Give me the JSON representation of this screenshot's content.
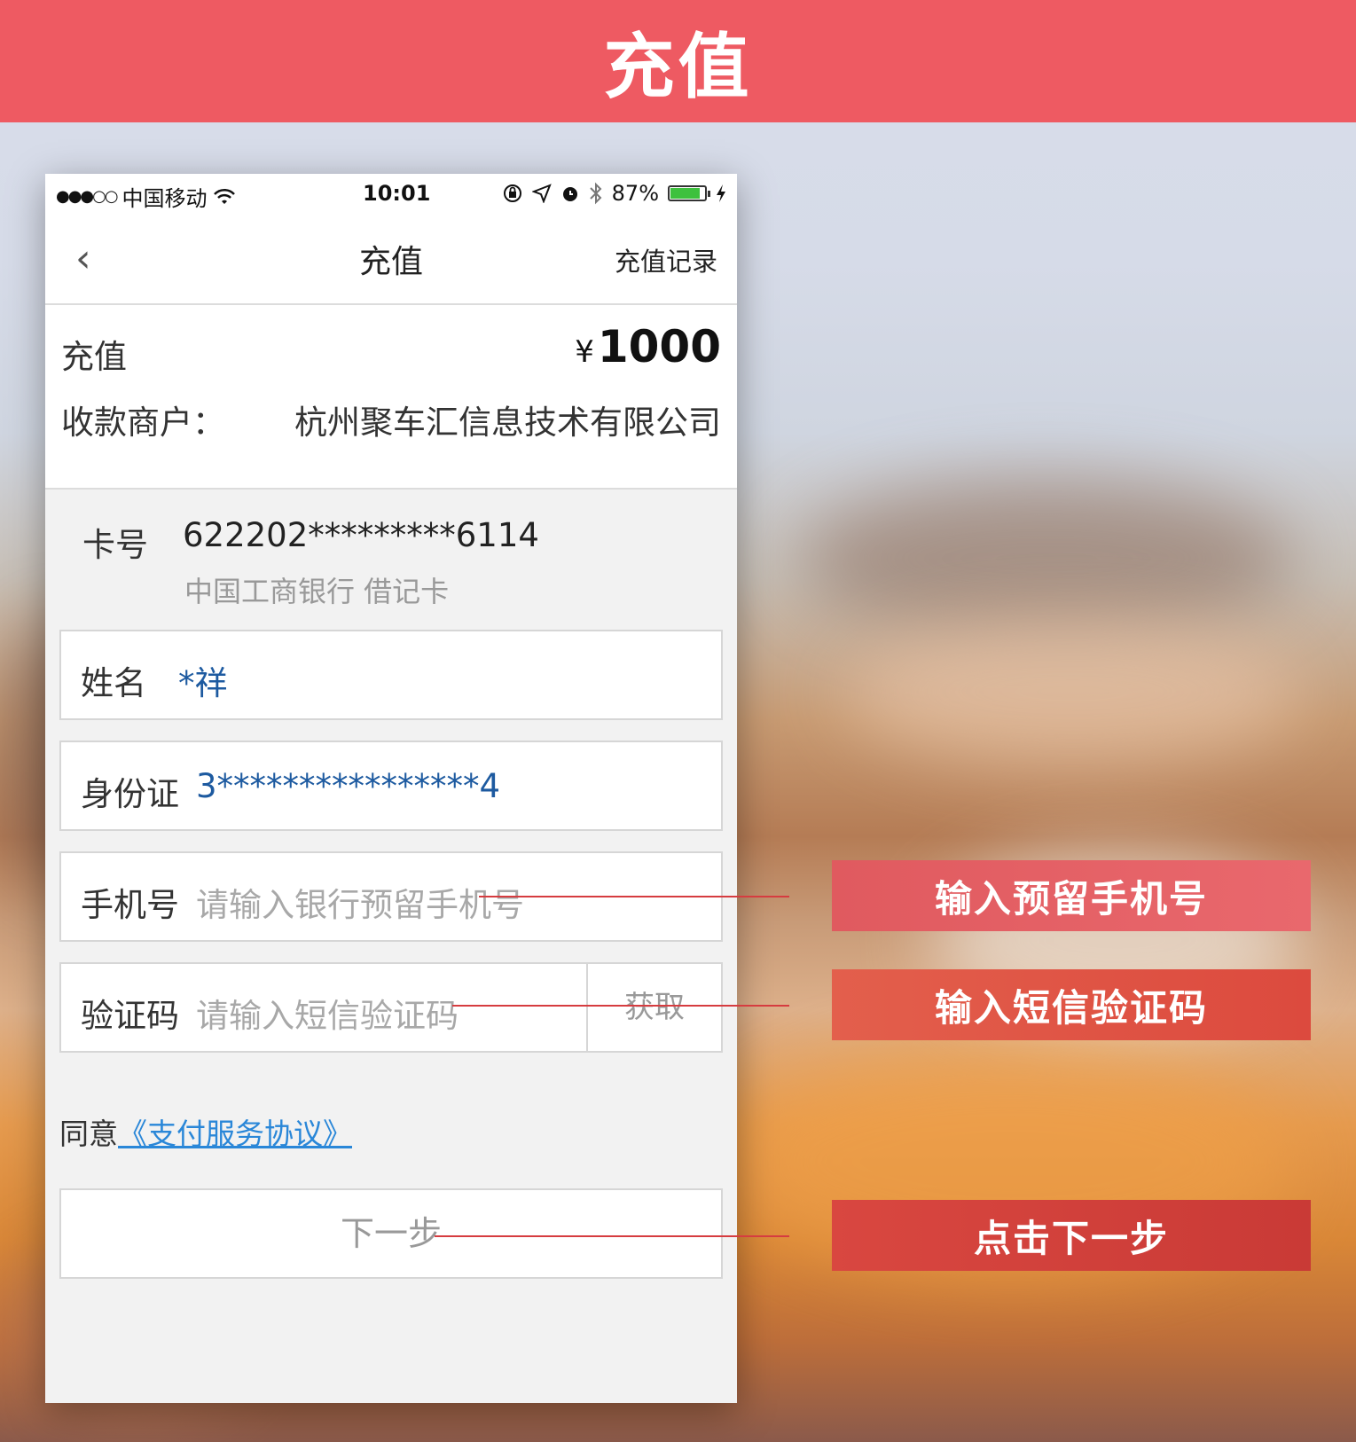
{
  "banner": {
    "title": "充值"
  },
  "status_bar": {
    "signal": "●●●○○",
    "carrier": "中国移动",
    "time": "10:01",
    "battery": "87%"
  },
  "nav": {
    "back": "‹",
    "title": "充值",
    "right_link": "充值记录"
  },
  "summary": {
    "label": "充值",
    "currency": "¥",
    "amount": "1000",
    "merchant_label": "收款商户：",
    "merchant": "杭州聚车汇信息技术有限公司"
  },
  "card": {
    "label": "卡号",
    "number": "622202*********6114",
    "bank": "中国工商银行 借记卡"
  },
  "form": {
    "name_label": "姓名",
    "name_value": "*祥",
    "id_label": "身份证",
    "id_value": "3****************4",
    "phone_label": "手机号",
    "phone_placeholder": "请输入银行预留手机号",
    "code_label": "验证码",
    "code_placeholder": "请输入短信验证码",
    "get_code": "获取"
  },
  "agreement": {
    "prefix": "同意",
    "link": "《支付服务协议》"
  },
  "next_button": "下一步",
  "callouts": {
    "phone": "输入预留手机号",
    "code": "输入短信验证码",
    "next": "点击下一步"
  },
  "colors": {
    "banner": "#ee5a62",
    "link": "#2a87d8",
    "field_value": "#1d5aa0",
    "callout_line": "#d63c40",
    "battery": "#3ec13e"
  }
}
